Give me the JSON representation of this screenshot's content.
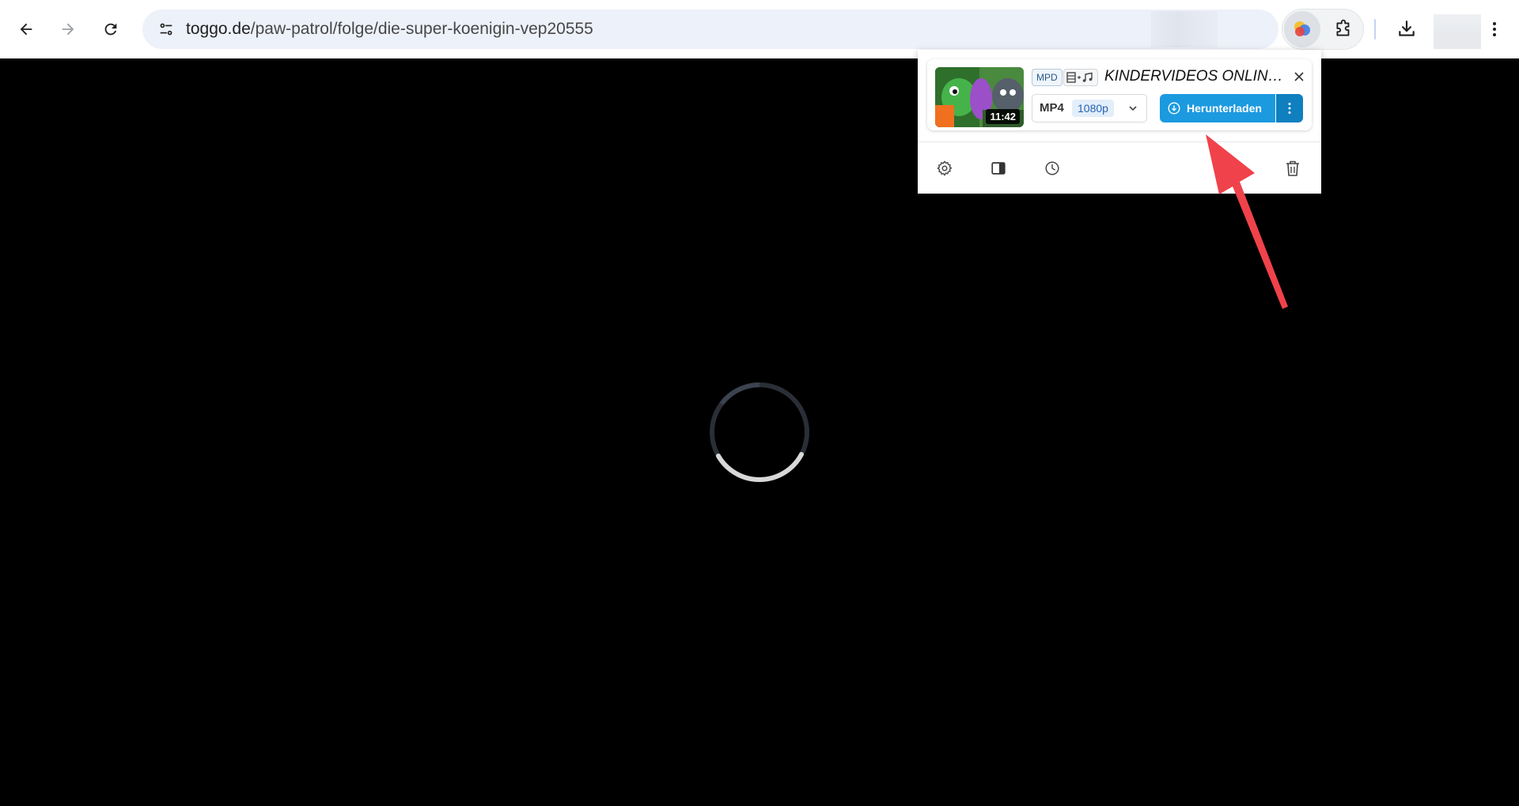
{
  "browser": {
    "url_host": "toggo.de",
    "url_path": "/paw-patrol/folge/die-super-koenigin-vep20555",
    "icons": [
      "back-icon",
      "forward-icon",
      "reload-icon",
      "site-info-icon",
      "extension-icon",
      "puzzle-icon",
      "download-icon",
      "more-vert-icon"
    ]
  },
  "popup": {
    "item": {
      "stream_badge": "MPD",
      "title": "KINDERVIDEOS ONLINE ...",
      "duration": "11:42",
      "format": "MP4",
      "resolution": "1080p",
      "download_label": "Herunterladen"
    },
    "footer_icons": [
      "gear-icon",
      "sidebar-icon",
      "history-icon",
      "trash-icon"
    ],
    "colors": {
      "primary": "#1b9ae0",
      "primary_dark": "#0f7fc0",
      "arrow": "#f0424a"
    }
  }
}
